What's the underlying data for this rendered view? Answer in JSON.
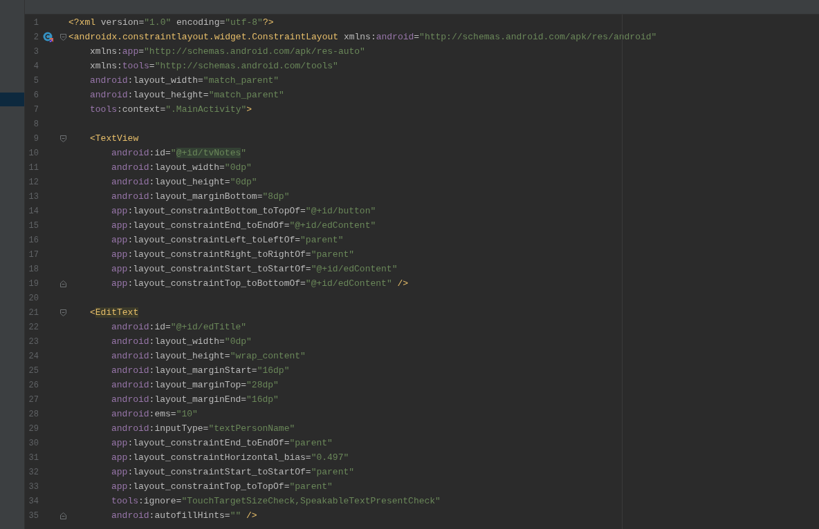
{
  "editor": {
    "lines": [
      {
        "number": "1",
        "kind": "plain",
        "tokens": [
          {
            "kind": "tag",
            "text": "<?xml"
          },
          {
            "kind": "plain",
            "text": " version="
          },
          {
            "kind": "value",
            "text": "\"1.0\""
          },
          {
            "kind": "plain",
            "text": " encoding="
          },
          {
            "kind": "value",
            "text": "\"utf-8\""
          },
          {
            "kind": "tag",
            "text": "?>"
          }
        ]
      },
      {
        "number": "2",
        "kind": "root-start",
        "tokens": [
          {
            "kind": "tag",
            "text": "<androidx.constraintlayout.widget.ConstraintLayout"
          },
          {
            "kind": "plain",
            "text": " xmlns:"
          },
          {
            "kind": "ns",
            "text": "android"
          },
          {
            "kind": "plain",
            "text": "="
          },
          {
            "kind": "value",
            "text": "\"http://schemas.android.com/apk/res/android\""
          }
        ],
        "children": [
          {
            "number": "3",
            "kind": "plain",
            "tokens": [
              {
                "kind": "plain",
                "text": "xmlns:"
              },
              {
                "kind": "ns",
                "text": "app"
              },
              {
                "kind": "plain",
                "text": "="
              },
              {
                "kind": "value",
                "text": "\"http://schemas.android.com/apk/res-auto\""
              }
            ]
          },
          {
            "number": "4",
            "kind": "plain",
            "tokens": [
              {
                "kind": "plain",
                "text": "xmlns:"
              },
              {
                "kind": "ns",
                "text": "tools"
              },
              {
                "kind": "plain",
                "text": "="
              },
              {
                "kind": "value",
                "text": "\"http://schemas.android.com/tools\""
              }
            ]
          },
          {
            "number": "5",
            "kind": "plain",
            "tokens": [
              {
                "kind": "ns",
                "text": "android"
              },
              {
                "kind": "plain",
                "text": ":layout_width="
              },
              {
                "kind": "value",
                "text": "\"match_parent\""
              }
            ]
          },
          {
            "number": "6",
            "kind": "plain",
            "tokens": [
              {
                "kind": "ns",
                "text": "android"
              },
              {
                "kind": "plain",
                "text": ":layout_height="
              },
              {
                "kind": "value",
                "text": "\"match_parent\""
              }
            ]
          },
          {
            "number": "7",
            "kind": "plain",
            "tokens": [
              {
                "kind": "ns",
                "text": "tools"
              },
              {
                "kind": "plain",
                "text": ":context="
              },
              {
                "kind": "value",
                "text": "\".MainActivity\""
              },
              {
                "kind": "tag",
                "text": ">"
              }
            ]
          },
          {
            "number": "8",
            "kind": "plain"
          },
          {
            "number": "9",
            "kind": "fold-start",
            "tokens": [
              {
                "kind": "tag",
                "text": "<TextView"
              }
            ],
            "children": [
              {
                "number": "10",
                "kind": "plain",
                "tokens": [
                  {
                    "kind": "ns",
                    "text": "android"
                  },
                  {
                    "kind": "plain",
                    "text": ":id="
                  },
                  {
                    "kind": "value",
                    "text": "\""
                  },
                  {
                    "kind": "value-usage",
                    "text": "@+id/tvNotes"
                  },
                  {
                    "kind": "value",
                    "text": "\""
                  }
                ]
              },
              {
                "number": "11",
                "kind": "plain",
                "tokens": [
                  {
                    "kind": "ns",
                    "text": "android"
                  },
                  {
                    "kind": "plain",
                    "text": ":layout_width="
                  },
                  {
                    "kind": "value",
                    "text": "\"0dp\""
                  }
                ]
              },
              {
                "number": "12",
                "kind": "plain",
                "tokens": [
                  {
                    "kind": "ns",
                    "text": "android"
                  },
                  {
                    "kind": "plain",
                    "text": ":layout_height="
                  },
                  {
                    "kind": "value",
                    "text": "\"0dp\""
                  }
                ]
              },
              {
                "number": "13",
                "kind": "plain",
                "tokens": [
                  {
                    "kind": "ns",
                    "text": "android"
                  },
                  {
                    "kind": "plain",
                    "text": ":layout_marginBottom="
                  },
                  {
                    "kind": "value",
                    "text": "\"8dp\""
                  }
                ]
              },
              {
                "number": "14",
                "kind": "plain",
                "tokens": [
                  {
                    "kind": "ns",
                    "text": "app"
                  },
                  {
                    "kind": "plain",
                    "text": ":layout_constraintBottom_toTopOf="
                  },
                  {
                    "kind": "value",
                    "text": "\"@+id/button\""
                  }
                ]
              },
              {
                "number": "15",
                "kind": "plain",
                "tokens": [
                  {
                    "kind": "ns",
                    "text": "app"
                  },
                  {
                    "kind": "plain",
                    "text": ":layout_constraintEnd_toEndOf="
                  },
                  {
                    "kind": "value",
                    "text": "\"@+id/edContent\""
                  }
                ]
              },
              {
                "number": "16",
                "kind": "plain",
                "tokens": [
                  {
                    "kind": "ns",
                    "text": "app"
                  },
                  {
                    "kind": "plain",
                    "text": ":layout_constraintLeft_toLeftOf="
                  },
                  {
                    "kind": "value",
                    "text": "\"parent\""
                  }
                ]
              },
              {
                "number": "17",
                "kind": "plain",
                "tokens": [
                  {
                    "kind": "ns",
                    "text": "app"
                  },
                  {
                    "kind": "plain",
                    "text": ":layout_constraintRight_toRightOf="
                  },
                  {
                    "kind": "value",
                    "text": "\"parent\""
                  }
                ]
              },
              {
                "number": "18",
                "kind": "plain",
                "tokens": [
                  {
                    "kind": "ns",
                    "text": "app"
                  },
                  {
                    "kind": "plain",
                    "text": ":layout_constraintStart_toStartOf="
                  },
                  {
                    "kind": "value",
                    "text": "\"@+id/edContent\""
                  }
                ]
              },
              {
                "number": "19",
                "kind": "fold-end",
                "tokens": [
                  {
                    "kind": "ns",
                    "text": "app"
                  },
                  {
                    "kind": "plain",
                    "text": ":layout_constraintTop_toBottomOf="
                  },
                  {
                    "kind": "value",
                    "text": "\"@+id/edContent\""
                  },
                  {
                    "kind": "tag",
                    "text": " />"
                  }
                ]
              }
            ]
          },
          {
            "number": "20",
            "kind": "plain"
          },
          {
            "number": "21",
            "kind": "fold-start",
            "tokens": [
              {
                "kind": "tag",
                "text": "<"
              },
              {
                "kind": "tag-match",
                "text": "EditText"
              }
            ],
            "children": [
              {
                "number": "22",
                "kind": "plain",
                "tokens": [
                  {
                    "kind": "ns",
                    "text": "android"
                  },
                  {
                    "kind": "plain",
                    "text": ":id="
                  },
                  {
                    "kind": "value",
                    "text": "\"@+id/edTitle\""
                  }
                ]
              },
              {
                "number": "23",
                "kind": "plain",
                "tokens": [
                  {
                    "kind": "ns",
                    "text": "android"
                  },
                  {
                    "kind": "plain",
                    "text": ":layout_width="
                  },
                  {
                    "kind": "value",
                    "text": "\"0dp\""
                  }
                ]
              },
              {
                "number": "24",
                "kind": "plain",
                "tokens": [
                  {
                    "kind": "ns",
                    "text": "android"
                  },
                  {
                    "kind": "plain",
                    "text": ":layout_height="
                  },
                  {
                    "kind": "value",
                    "text": "\"wrap_content\""
                  }
                ]
              },
              {
                "number": "25",
                "kind": "plain",
                "tokens": [
                  {
                    "kind": "ns",
                    "text": "android"
                  },
                  {
                    "kind": "plain",
                    "text": ":layout_marginStart="
                  },
                  {
                    "kind": "value",
                    "text": "\"16dp\""
                  }
                ]
              },
              {
                "number": "26",
                "kind": "plain",
                "tokens": [
                  {
                    "kind": "ns",
                    "text": "android"
                  },
                  {
                    "kind": "plain",
                    "text": ":layout_marginTop="
                  },
                  {
                    "kind": "value",
                    "text": "\"28dp\""
                  }
                ]
              },
              {
                "number": "27",
                "kind": "plain",
                "tokens": [
                  {
                    "kind": "ns",
                    "text": "android"
                  },
                  {
                    "kind": "plain",
                    "text": ":layout_marginEnd="
                  },
                  {
                    "kind": "value",
                    "text": "\"16dp\""
                  }
                ]
              },
              {
                "number": "28",
                "kind": "plain",
                "tokens": [
                  {
                    "kind": "ns",
                    "text": "android"
                  },
                  {
                    "kind": "plain",
                    "text": ":ems="
                  },
                  {
                    "kind": "value",
                    "text": "\"10\""
                  }
                ]
              },
              {
                "number": "29",
                "kind": "plain",
                "tokens": [
                  {
                    "kind": "ns",
                    "text": "android"
                  },
                  {
                    "kind": "plain",
                    "text": ":inputType="
                  },
                  {
                    "kind": "value",
                    "text": "\"textPersonName\""
                  }
                ]
              },
              {
                "number": "30",
                "kind": "plain",
                "tokens": [
                  {
                    "kind": "ns",
                    "text": "app"
                  },
                  {
                    "kind": "plain",
                    "text": ":layout_constraintEnd_toEndOf="
                  },
                  {
                    "kind": "value",
                    "text": "\"parent\""
                  }
                ]
              },
              {
                "number": "31",
                "kind": "plain",
                "tokens": [
                  {
                    "kind": "ns",
                    "text": "app"
                  },
                  {
                    "kind": "plain",
                    "text": ":layout_constraintHorizontal_bias="
                  },
                  {
                    "kind": "value",
                    "text": "\"0.497\""
                  }
                ]
              },
              {
                "number": "32",
                "kind": "plain",
                "tokens": [
                  {
                    "kind": "ns",
                    "text": "app"
                  },
                  {
                    "kind": "plain",
                    "text": ":layout_constraintStart_toStartOf="
                  },
                  {
                    "kind": "value",
                    "text": "\"parent\""
                  }
                ]
              },
              {
                "number": "33",
                "kind": "plain",
                "tokens": [
                  {
                    "kind": "ns",
                    "text": "app"
                  },
                  {
                    "kind": "plain",
                    "text": ":layout_constraintTop_toTopOf="
                  },
                  {
                    "kind": "value",
                    "text": "\"parent\""
                  }
                ]
              },
              {
                "number": "34",
                "kind": "plain",
                "tokens": [
                  {
                    "kind": "ns",
                    "text": "tools"
                  },
                  {
                    "kind": "plain",
                    "text": ":ignore="
                  },
                  {
                    "kind": "value",
                    "text": "\"TouchTargetSizeCheck,SpeakableTextPresentCheck\""
                  }
                ]
              },
              {
                "number": "35",
                "kind": "fold-end",
                "tokens": [
                  {
                    "kind": "ns",
                    "text": "android"
                  },
                  {
                    "kind": "plain",
                    "text": ":autofillHints="
                  },
                  {
                    "kind": "value",
                    "text": "\"\""
                  },
                  {
                    "kind": "tag",
                    "text": " />"
                  }
                ]
              }
            ]
          }
        ]
      }
    ]
  }
}
